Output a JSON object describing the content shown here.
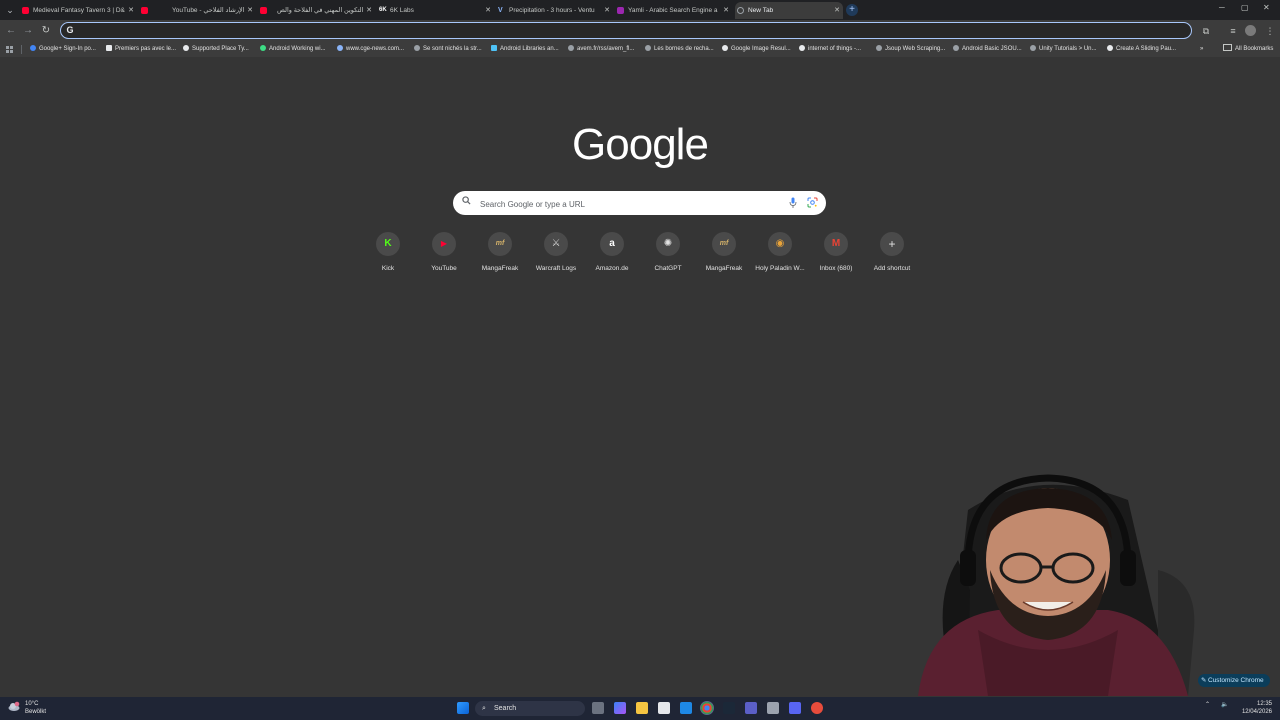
{
  "tabs": [
    {
      "title": "Medieval Fantasy Tavern 3 | D&",
      "favicon": "youtube-icon",
      "active": false
    },
    {
      "title": "YouTube - الإرشاد الفلاحي",
      "favicon": "youtube-icon",
      "active": false
    },
    {
      "title": "التكوين المهني في الفلاحة والص",
      "favicon": "youtube-icon",
      "active": false
    },
    {
      "title": "6K Labs",
      "favicon": "sixk-icon",
      "active": false
    },
    {
      "title": "Precipitation - 3 hours - Ventu",
      "favicon": "ventusky-icon",
      "active": false
    },
    {
      "title": "Yamli - Arabic Search Engine a",
      "favicon": "yamli-icon",
      "active": false
    },
    {
      "title": "New Tab",
      "favicon": "new-tab-icon",
      "active": true
    }
  ],
  "omnibox": {
    "value": "",
    "placeholder": ""
  },
  "bookmarks": [
    "Google+ Sign-In po...",
    "Premiers pas avec le...",
    "Supported Place Ty...",
    "Android Working wi...",
    "www.cge-news.com...",
    "Se sont nichés la str...",
    "Android Libraries an...",
    "avem.fr/rss/avem_fl...",
    "Les bornes de recha...",
    "Google Image Resul...",
    "internet of things -...",
    "Jsoup Web Scraping...",
    "Android Basic JSOU...",
    "Unity Tutorials > Un...",
    "Create A Sliding Pau..."
  ],
  "all_bookmarks": "All Bookmarks",
  "logo": "Google",
  "search": {
    "placeholder": "Search Google or type a URL"
  },
  "shortcuts": [
    {
      "label": "Kick",
      "glyph": "K",
      "color": "#53fc18"
    },
    {
      "label": "YouTube",
      "glyph": "▶",
      "color": "#ff0033"
    },
    {
      "label": "MangaFreak",
      "glyph": "mf",
      "color": "#d4b26a"
    },
    {
      "label": "Warcraft Logs",
      "glyph": "⚔",
      "color": "#cfcfcf"
    },
    {
      "label": "Amazon.de",
      "glyph": "a",
      "color": "#ffffff"
    },
    {
      "label": "ChatGPT",
      "glyph": "✺",
      "color": "#e3e3e3"
    },
    {
      "label": "MangaFreak",
      "glyph": "mf",
      "color": "#d4b26a"
    },
    {
      "label": "Holy Paladin W...",
      "glyph": "◉",
      "color": "#e8a33a"
    },
    {
      "label": "Inbox (680)",
      "glyph": "M",
      "color": "#ea4335"
    },
    {
      "label": "Add shortcut",
      "glyph": "+",
      "color": "#e3e3e3"
    }
  ],
  "customize_label": "Customize Chrome",
  "taskbar": {
    "weather_temp": "10°C",
    "weather_desc": "Bewölkt",
    "search_label": "Search",
    "time": "12:35",
    "date": "12/04/2026"
  }
}
